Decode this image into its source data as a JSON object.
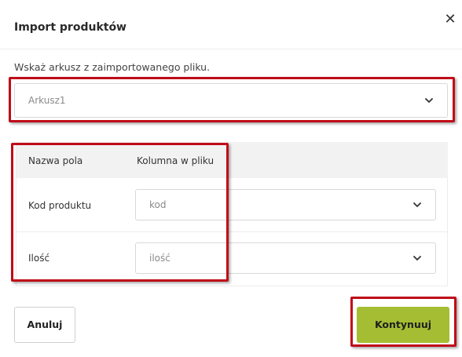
{
  "modal": {
    "title": "Import produktów",
    "instruction": "Wskaż arkusz z zaimportowanego pliku.",
    "sheet_select": {
      "value": "Arkusz1"
    },
    "mapping_table": {
      "headers": {
        "field_name": "Nazwa pola",
        "file_column": "Kolumna w pliku"
      },
      "rows": [
        {
          "label": "Kod produktu",
          "value": "kod"
        },
        {
          "label": "Ilość",
          "value": "ilość"
        }
      ]
    },
    "buttons": {
      "cancel": "Anuluj",
      "continue": "Kontynuuj"
    },
    "close_icon": "close-icon"
  },
  "colors": {
    "accent": "#a5bd32",
    "highlight": "#c00b18",
    "table_header_bg": "#f2f2f2"
  }
}
